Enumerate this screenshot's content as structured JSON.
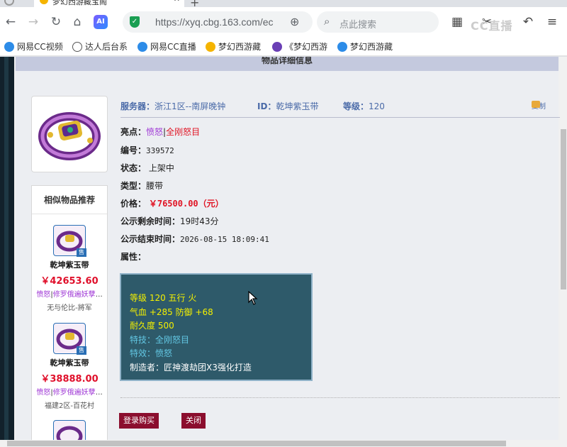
{
  "browser": {
    "tab_title": "梦幻西游藏宝阁",
    "url": "https://xyq.cbg.163.com/ec",
    "search_placeholder": "点此搜索",
    "ai_label": "AI",
    "watermark": "CC直播",
    "bookmarks": [
      "网易CC视频",
      "达人后台系",
      "网易CC直播",
      "梦幻西游藏",
      "《梦幻西游",
      "梦幻西游藏"
    ]
  },
  "page": {
    "header_title": "物品详细信息",
    "similar_title": "相似物品推荐",
    "server_label": "服务器：",
    "server_value": "浙江1区--南屏晚钟",
    "id_label": "ID：",
    "id_value": "乾坤紫玉带",
    "level_label": "等级：",
    "level_value": "120",
    "favorite_label": "复制",
    "highlight_label": "亮点：",
    "highlight_1": "愤怒",
    "highlight_sep": "|",
    "highlight_2": "全刚怒目",
    "serial_label": "编号：",
    "serial_value": "339572",
    "status_label": "状态：",
    "status_value": "上架中",
    "type_label": "类型：",
    "type_value": "腰带",
    "price_label": "价格：",
    "price_value": "￥76500.00（元）",
    "remain_label": "公示剩余时间：",
    "remain_value": "19时43分",
    "end_label": "公示结束时间：",
    "end_value": "2026-08-15 18:09:41",
    "attr_label": "属性：",
    "attrs": {
      "line1": "等级 120 五行 火",
      "line2": "气血 +285 防御 +68",
      "line3": "耐久度 500",
      "line4": "特技：全刚怒目",
      "line5": "特效：愤怒",
      "line6": "制造者：匠神渡劫团X3强化打造"
    },
    "buy_button": "登录购买",
    "close_button": "关闭"
  },
  "similar_items": [
    {
      "name": "乾坤紫玉带",
      "price": "￥42653.60",
      "attr_a": "愤怒",
      "attr_b": "修罗俄遍妖孽",
      "more": "…",
      "server": "无与伦比-將军",
      "tag": "售"
    },
    {
      "name": "乾坤紫玉带",
      "price": "￥38888.00",
      "attr_a": "愤怒",
      "attr_b": "修罗俄遍妖孽",
      "more": "…",
      "server": "福建2区-百花村",
      "tag": "售"
    }
  ],
  "colors": {
    "accent_blue": "#4a6aa8",
    "price_red": "#e01424",
    "button_maroon": "#8b0e2e",
    "attr_bg": "#2e5a6a"
  }
}
